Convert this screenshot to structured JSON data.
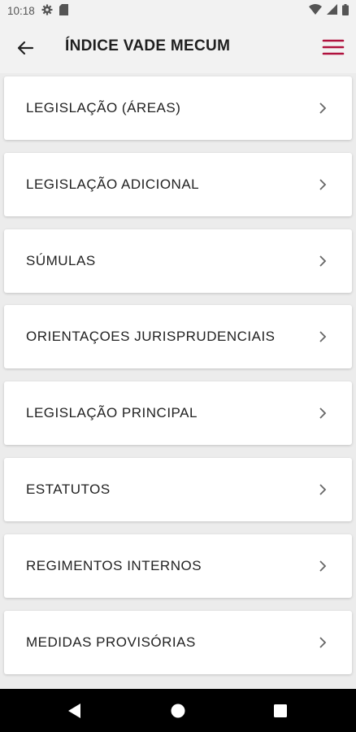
{
  "status_bar": {
    "time": "10:18",
    "icons_left": [
      "gear-icon",
      "sim-card-icon"
    ],
    "icons_right": [
      "wifi-icon",
      "signal-icon",
      "battery-icon"
    ]
  },
  "appbar": {
    "title": "ÍNDICE VADE MECUM",
    "back_icon": "arrow-left-icon",
    "menu_icon": "hamburger-menu-icon",
    "menu_color": "#b0123e"
  },
  "menu_items": [
    {
      "label": "LEGISLAÇÃO (ÁREAS)"
    },
    {
      "label": "LEGISLAÇÃO ADICIONAL"
    },
    {
      "label": "SÚMULAS"
    },
    {
      "label": "ORIENTAÇOES JURISPRUDENCIAIS"
    },
    {
      "label": "LEGISLAÇÃO PRINCIPAL"
    },
    {
      "label": "ESTATUTOS"
    },
    {
      "label": "REGIMENTOS INTERNOS"
    },
    {
      "label": "MEDIDAS PROVISÓRIAS"
    }
  ],
  "nav_bar": {
    "buttons": [
      "back-triangle-icon",
      "home-circle-icon",
      "recents-square-icon"
    ]
  }
}
